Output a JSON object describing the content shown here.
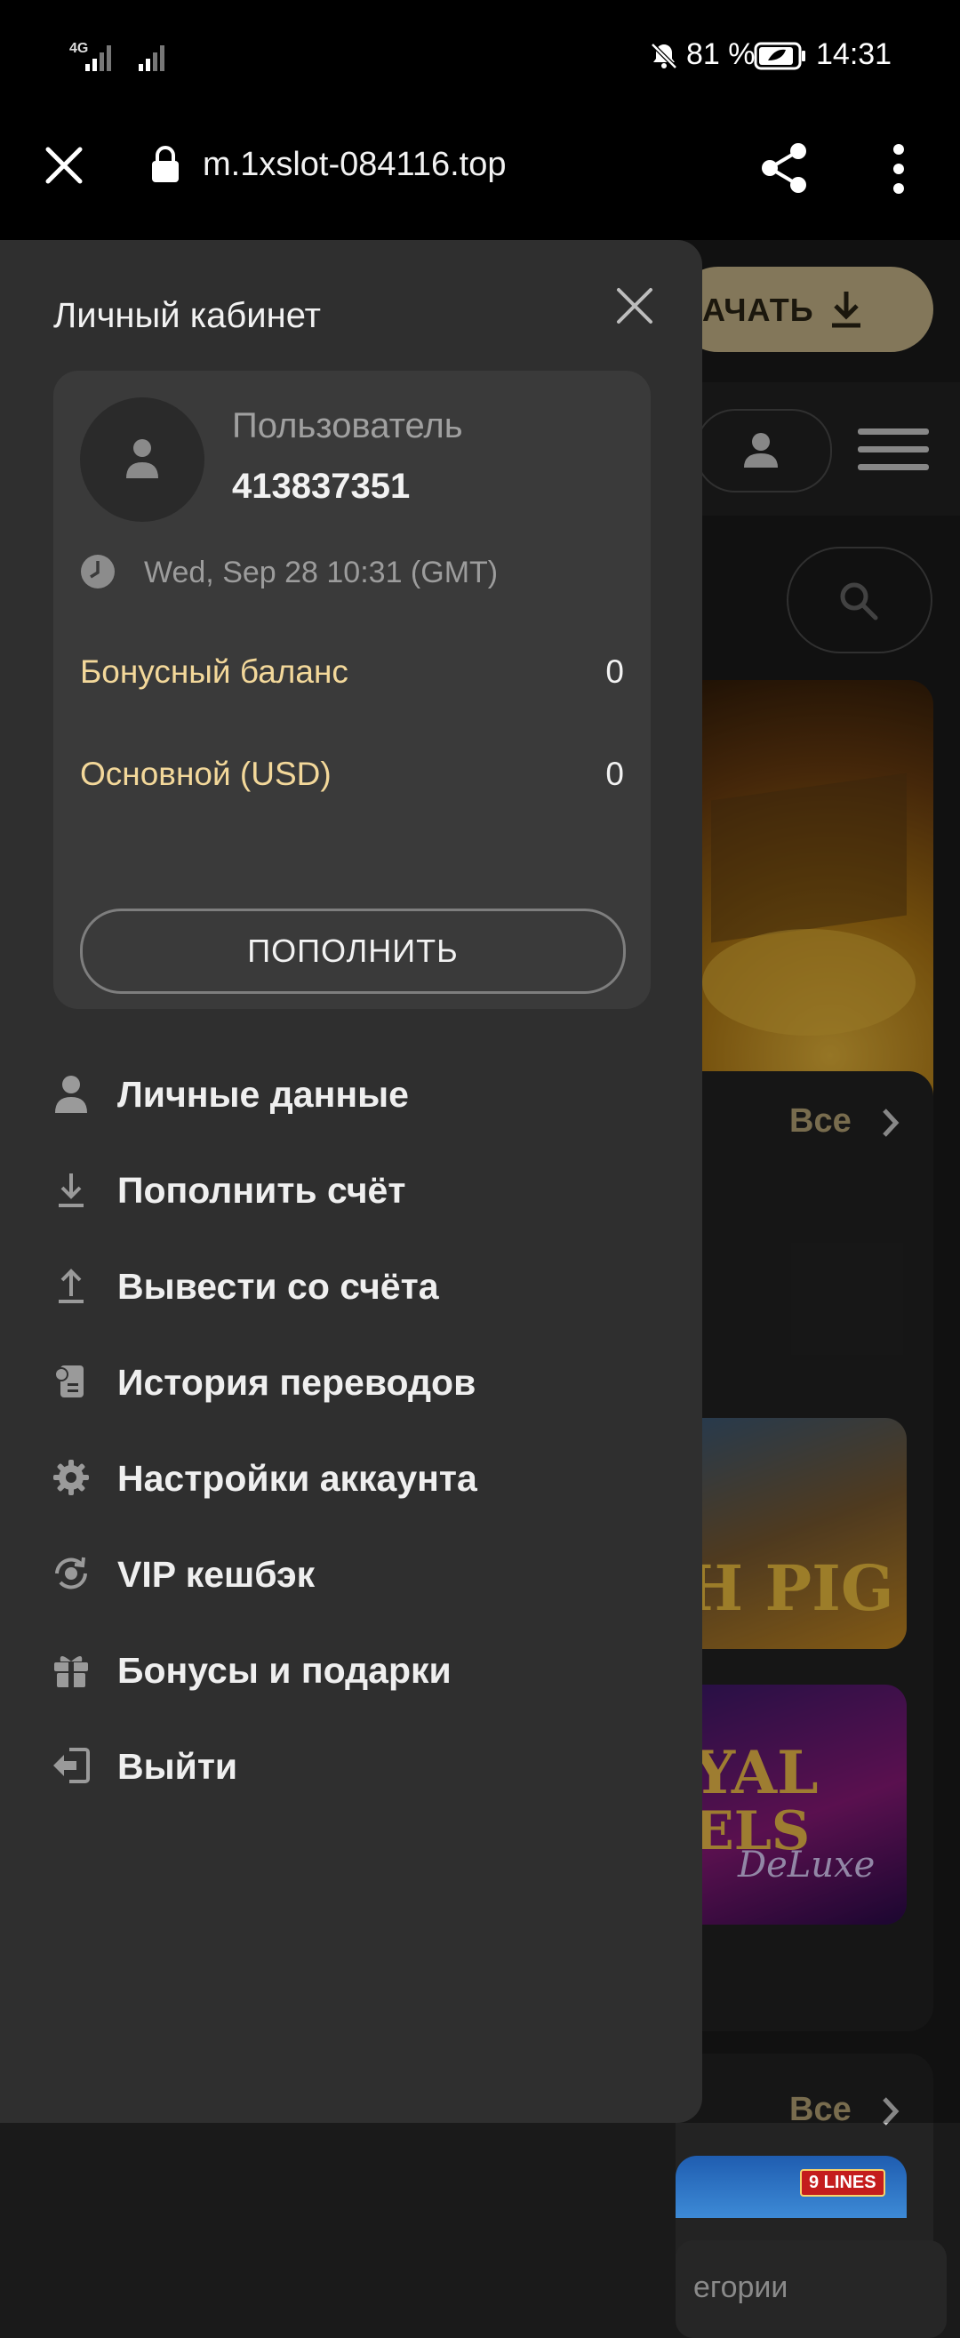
{
  "status_bar": {
    "network": "4G",
    "battery_percent": "81 %",
    "time": "14:31"
  },
  "browser": {
    "url": "m.1xslot-084116.top"
  },
  "background_page": {
    "download_label": "АЧАТЬ",
    "section1_all": "Все",
    "section2_all": "Все",
    "thumb1_text": "H PIG",
    "thumb2_text": "YAL",
    "thumb2_sub": "ELS",
    "thumb2_script": "DeLuxe",
    "thumb3_badge": "9 LINES",
    "categories_text": "егории"
  },
  "drawer": {
    "title": "Личный кабинет",
    "user_label": "Пользователь",
    "user_id": "413837351",
    "datetime": "Wed, Sep 28 10:31 (GMT)",
    "balances": [
      {
        "label": "Бонусный баланс",
        "value": "0"
      },
      {
        "label": "Основной (USD)",
        "value": "0"
      }
    ],
    "topup_button": "ПОПОЛНИТЬ",
    "menu": [
      {
        "label": "Личные данные",
        "icon": "user-icon"
      },
      {
        "label": "Пополнить счёт",
        "icon": "download-icon"
      },
      {
        "label": "Вывести со счёта",
        "icon": "upload-icon"
      },
      {
        "label": "История переводов",
        "icon": "history-icon"
      },
      {
        "label": "Настройки аккаунта",
        "icon": "gear-icon"
      },
      {
        "label": "VIP кешбэк",
        "icon": "cashback-icon"
      },
      {
        "label": "Бонусы и подарки",
        "icon": "gift-icon"
      },
      {
        "label": "Выйти",
        "icon": "logout-icon"
      }
    ]
  }
}
